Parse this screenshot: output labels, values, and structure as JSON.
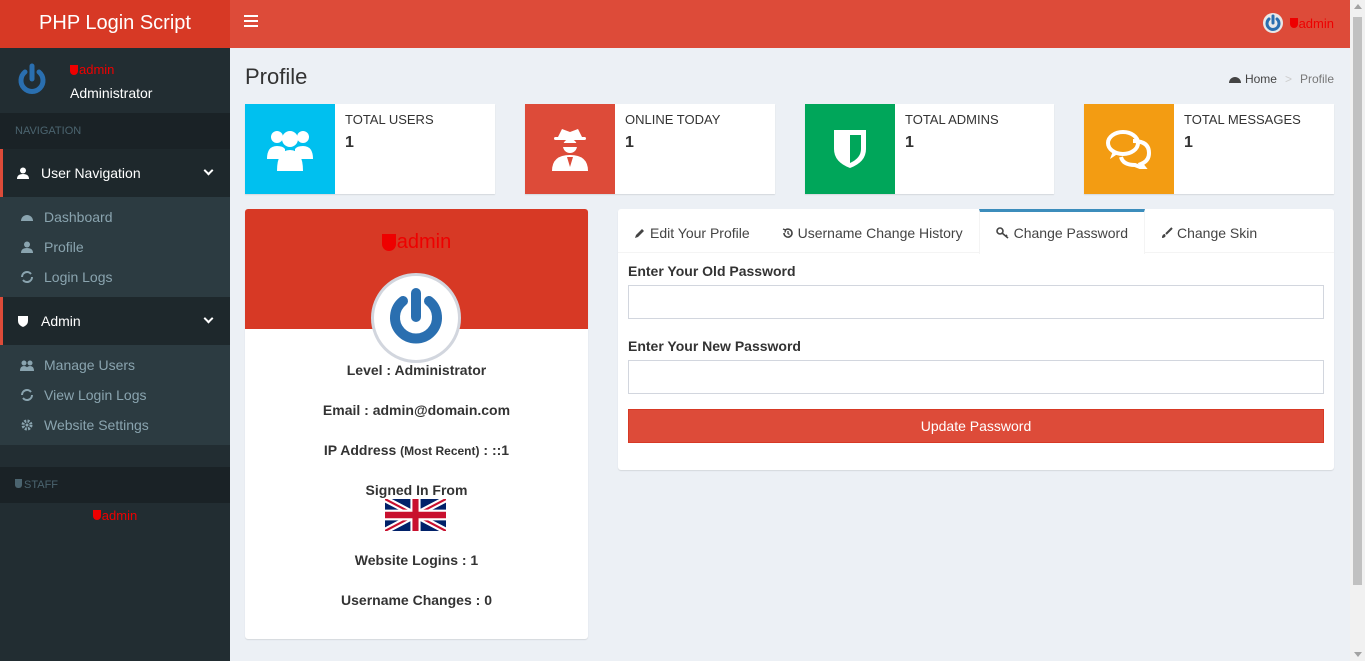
{
  "header": {
    "brand": "PHP Login Script",
    "user_name": "admin"
  },
  "sidebar": {
    "user": {
      "name": "admin",
      "role": "Administrator"
    },
    "nav_label": "NAVIGATION",
    "sections": [
      {
        "title": "User Navigation",
        "items": [
          {
            "label": "Dashboard",
            "icon": "dashboard-icon"
          },
          {
            "label": "Profile",
            "icon": "user-icon"
          },
          {
            "label": "Login Logs",
            "icon": "refresh-icon"
          }
        ]
      },
      {
        "title": "Admin",
        "items": [
          {
            "label": "Manage Users",
            "icon": "users-icon"
          },
          {
            "label": "View Login Logs",
            "icon": "refresh-icon"
          },
          {
            "label": "Website Settings",
            "icon": "gear-icon"
          }
        ]
      }
    ],
    "staff_label": "STAFF",
    "staff_user": "admin"
  },
  "page": {
    "title": "Profile",
    "breadcrumb": {
      "home": "Home",
      "current": "Profile"
    }
  },
  "stats": [
    {
      "label": "TOTAL USERS",
      "value": "1",
      "color": "#00c0ef",
      "icon": "users-icon"
    },
    {
      "label": "ONLINE TODAY",
      "value": "1",
      "color": "#dd4b39",
      "icon": "spy-icon"
    },
    {
      "label": "TOTAL ADMINS",
      "value": "1",
      "color": "#00a65a",
      "icon": "shield-icon"
    },
    {
      "label": "TOTAL MESSAGES",
      "value": "1",
      "color": "#f39c12",
      "icon": "comments-icon"
    }
  ],
  "profile": {
    "name": "admin",
    "level_label": "Level :",
    "level": "Administrator",
    "email_label": "Email :",
    "email": "admin@domain.com",
    "ip_label": "IP Address",
    "ip_note": "(Most Recent)",
    "ip": ": ::1",
    "signed_in_from": "Signed In From",
    "logins_label": "Website Logins :",
    "logins": "1",
    "changes_label": "Username Changes :",
    "changes": "0"
  },
  "tabs": [
    {
      "label": "Edit Your Profile",
      "icon": "pencil-icon"
    },
    {
      "label": "Username Change History",
      "icon": "history-icon"
    },
    {
      "label": "Change Password",
      "icon": "key-icon",
      "active": true
    },
    {
      "label": "Change Skin",
      "icon": "brush-icon"
    }
  ],
  "form": {
    "old_label": "Enter Your Old Password",
    "old_value": "",
    "new_label": "Enter Your New Password",
    "new_value": "",
    "submit": "Update Password"
  },
  "colors": {
    "header": "#dd4b39",
    "brand": "#d73925",
    "sidebar": "#222d32",
    "active_tab": "#3c8dbc"
  }
}
